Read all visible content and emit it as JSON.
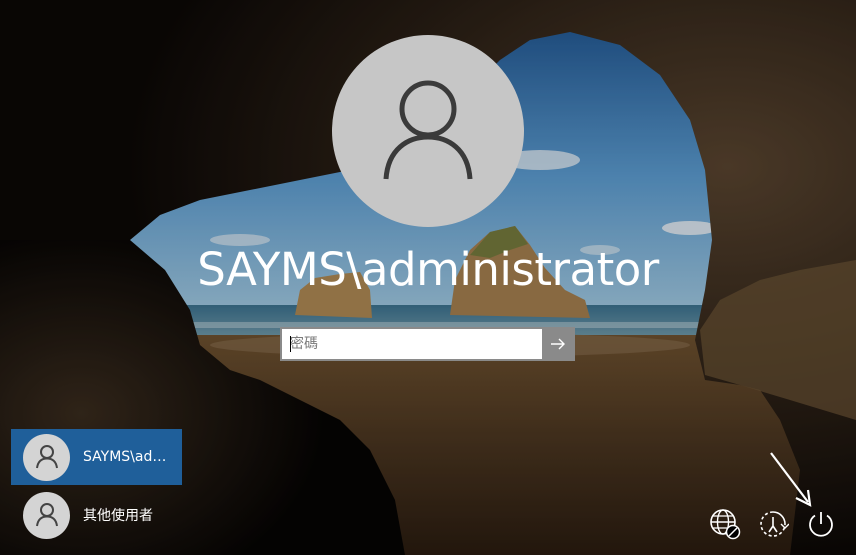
{
  "login": {
    "username": "SAYMS\\administrator",
    "password_placeholder": "密碼",
    "password_value": ""
  },
  "user_list": {
    "items": [
      {
        "label": "SAYMS\\administrator",
        "display": "SAYMS\\ad…",
        "selected": true,
        "icon": "user-icon"
      },
      {
        "label": "其他使用者",
        "display": "其他使用者",
        "selected": false,
        "icon": "user-icon"
      }
    ]
  },
  "system_buttons": [
    {
      "name": "network",
      "icon": "network-icon"
    },
    {
      "name": "ease-of-access",
      "icon": "ease-of-access-icon"
    },
    {
      "name": "power",
      "icon": "power-icon"
    }
  ],
  "colors": {
    "selected_user": "#1f5f9a",
    "avatar_bg": "#c6c6c6",
    "submit_button": "#8a8a8a",
    "text": "#ffffff"
  }
}
